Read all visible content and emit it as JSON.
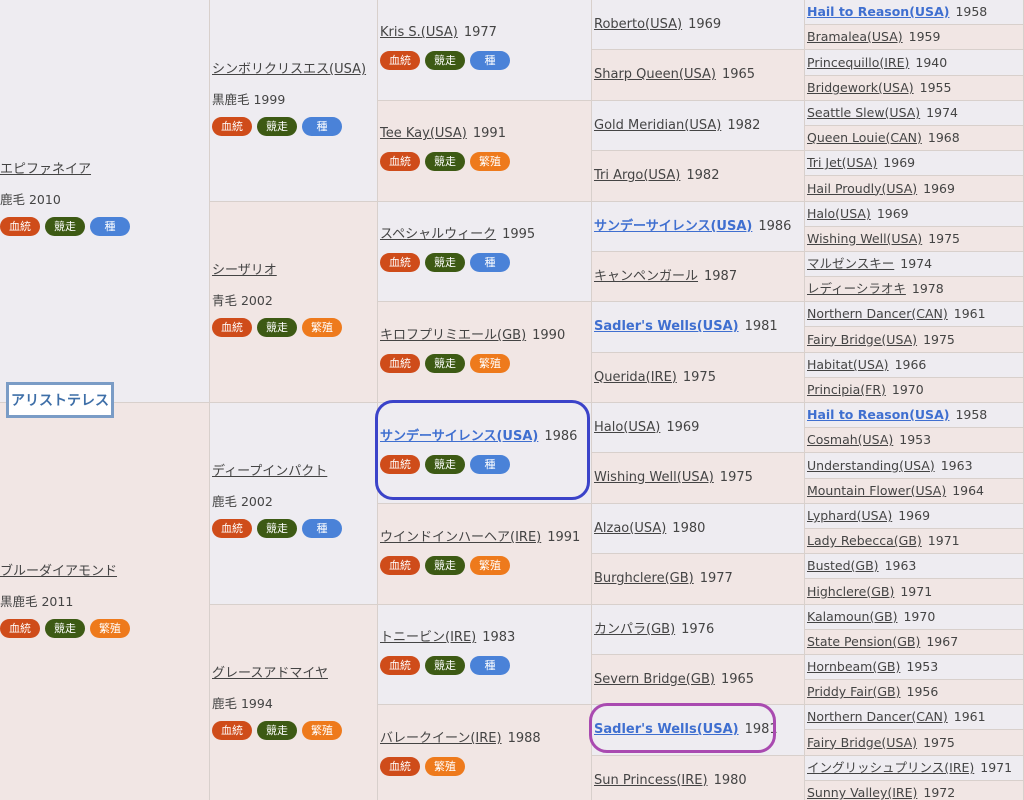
{
  "highlight_label": "アリストテレス",
  "gen1": [
    {
      "name": "エピファネイア",
      "year": "",
      "coat": "鹿毛 2010",
      "bold": false,
      "badges": [
        "血統",
        "競走",
        "種"
      ]
    },
    {
      "name": "ブルーダイアモンド",
      "year": "",
      "coat": "黒鹿毛 2011",
      "bold": false,
      "badges": [
        "血統",
        "競走",
        "繁殖"
      ]
    }
  ],
  "gen2": [
    {
      "name": "シンボリクリスエス(USA)",
      "year": "",
      "coat": "黒鹿毛 1999",
      "bold": false,
      "badges": [
        "血統",
        "競走",
        "種"
      ]
    },
    {
      "name": "シーザリオ",
      "year": "",
      "coat": "青毛 2002",
      "bold": false,
      "badges": [
        "血統",
        "競走",
        "繁殖"
      ]
    },
    {
      "name": "ディープインパクト",
      "year": "",
      "coat": "鹿毛 2002",
      "bold": false,
      "badges": [
        "血統",
        "競走",
        "種"
      ]
    },
    {
      "name": "グレースアドマイヤ",
      "year": "",
      "coat": "鹿毛 1994",
      "bold": false,
      "badges": [
        "血統",
        "競走",
        "繁殖"
      ]
    }
  ],
  "gen3": [
    {
      "name": "Kris S.(USA)",
      "year": "1977",
      "bold": false,
      "badges": [
        "血統",
        "競走",
        "種"
      ]
    },
    {
      "name": "Tee Kay(USA)",
      "year": "1991",
      "bold": false,
      "badges": [
        "血統",
        "競走",
        "繁殖"
      ]
    },
    {
      "name": "スペシャルウィーク",
      "year": "1995",
      "bold": false,
      "badges": [
        "血統",
        "競走",
        "種"
      ]
    },
    {
      "name": "キロフプリミエール(GB)",
      "year": "1990",
      "bold": false,
      "badges": [
        "血統",
        "競走",
        "繁殖"
      ]
    },
    {
      "name": "サンデーサイレンス(USA)",
      "year": "1986",
      "bold": true,
      "badges": [
        "血統",
        "競走",
        "種"
      ]
    },
    {
      "name": "ウインドインハーヘア(IRE)",
      "year": "1991",
      "bold": false,
      "badges": [
        "血統",
        "競走",
        "繁殖"
      ]
    },
    {
      "name": "トニービン(IRE)",
      "year": "1983",
      "bold": false,
      "badges": [
        "血統",
        "競走",
        "種"
      ]
    },
    {
      "name": "バレークイーン(IRE)",
      "year": "1988",
      "bold": false,
      "badges": [
        "血統",
        "繁殖"
      ]
    }
  ],
  "gen4": [
    {
      "name": "Roberto(USA)",
      "year": "1969",
      "bold": false
    },
    {
      "name": "Sharp Queen(USA)",
      "year": "1965",
      "bold": false
    },
    {
      "name": "Gold Meridian(USA)",
      "year": "1982",
      "bold": false
    },
    {
      "name": "Tri Argo(USA)",
      "year": "1982",
      "bold": false
    },
    {
      "name": "サンデーサイレンス(USA)",
      "year": "1986",
      "bold": true
    },
    {
      "name": "キャンペンガール",
      "year": "1987",
      "bold": false
    },
    {
      "name": "Sadler's Wells(USA)",
      "year": "1981",
      "bold": true
    },
    {
      "name": "Querida(IRE)",
      "year": "1975",
      "bold": false
    },
    {
      "name": "Halo(USA)",
      "year": "1969",
      "bold": false
    },
    {
      "name": "Wishing Well(USA)",
      "year": "1975",
      "bold": false
    },
    {
      "name": "Alzao(USA)",
      "year": "1980",
      "bold": false
    },
    {
      "name": "Burghclere(GB)",
      "year": "1977",
      "bold": false
    },
    {
      "name": "カンパラ(GB)",
      "year": "1976",
      "bold": false
    },
    {
      "name": "Severn Bridge(GB)",
      "year": "1965",
      "bold": false
    },
    {
      "name": "Sadler's Wells(USA)",
      "year": "1981",
      "bold": true
    },
    {
      "name": "Sun Princess(IRE)",
      "year": "1980",
      "bold": false
    }
  ],
  "gen5": [
    {
      "name": "Hail to Reason(USA)",
      "year": "1958",
      "bold": true
    },
    {
      "name": "Bramalea(USA)",
      "year": "1959",
      "bold": false
    },
    {
      "name": "Princequillo(IRE)",
      "year": "1940",
      "bold": false
    },
    {
      "name": "Bridgework(USA)",
      "year": "1955",
      "bold": false
    },
    {
      "name": "Seattle Slew(USA)",
      "year": "1974",
      "bold": false
    },
    {
      "name": "Queen Louie(CAN)",
      "year": "1968",
      "bold": false
    },
    {
      "name": "Tri Jet(USA)",
      "year": "1969",
      "bold": false
    },
    {
      "name": "Hail Proudly(USA)",
      "year": "1969",
      "bold": false
    },
    {
      "name": "Halo(USA)",
      "year": "1969",
      "bold": false
    },
    {
      "name": "Wishing Well(USA)",
      "year": "1975",
      "bold": false
    },
    {
      "name": "マルゼンスキー",
      "year": "1974",
      "bold": false
    },
    {
      "name": "レディーシラオキ",
      "year": "1978",
      "bold": false
    },
    {
      "name": "Northern Dancer(CAN)",
      "year": "1961",
      "bold": false
    },
    {
      "name": "Fairy Bridge(USA)",
      "year": "1975",
      "bold": false
    },
    {
      "name": "Habitat(USA)",
      "year": "1966",
      "bold": false
    },
    {
      "name": "Principia(FR)",
      "year": "1970",
      "bold": false
    },
    {
      "name": "Hail to Reason(USA)",
      "year": "1958",
      "bold": true
    },
    {
      "name": "Cosmah(USA)",
      "year": "1953",
      "bold": false
    },
    {
      "name": "Understanding(USA)",
      "year": "1963",
      "bold": false
    },
    {
      "name": "Mountain Flower(USA)",
      "year": "1964",
      "bold": false
    },
    {
      "name": "Lyphard(USA)",
      "year": "1969",
      "bold": false
    },
    {
      "name": "Lady Rebecca(GB)",
      "year": "1971",
      "bold": false
    },
    {
      "name": "Busted(GB)",
      "year": "1963",
      "bold": false
    },
    {
      "name": "Highclere(GB)",
      "year": "1971",
      "bold": false
    },
    {
      "name": "Kalamoun(GB)",
      "year": "1970",
      "bold": false
    },
    {
      "name": "State Pension(GB)",
      "year": "1967",
      "bold": false
    },
    {
      "name": "Hornbeam(GB)",
      "year": "1953",
      "bold": false
    },
    {
      "name": "Priddy Fair(GB)",
      "year": "1956",
      "bold": false
    },
    {
      "name": "Northern Dancer(CAN)",
      "year": "1961",
      "bold": false
    },
    {
      "name": "Fairy Bridge(USA)",
      "year": "1975",
      "bold": false
    },
    {
      "name": "イングリッシュプリンス(IRE)",
      "year": "1971",
      "bold": false
    },
    {
      "name": "Sunny Valley(IRE)",
      "year": "1972",
      "bold": false
    }
  ]
}
